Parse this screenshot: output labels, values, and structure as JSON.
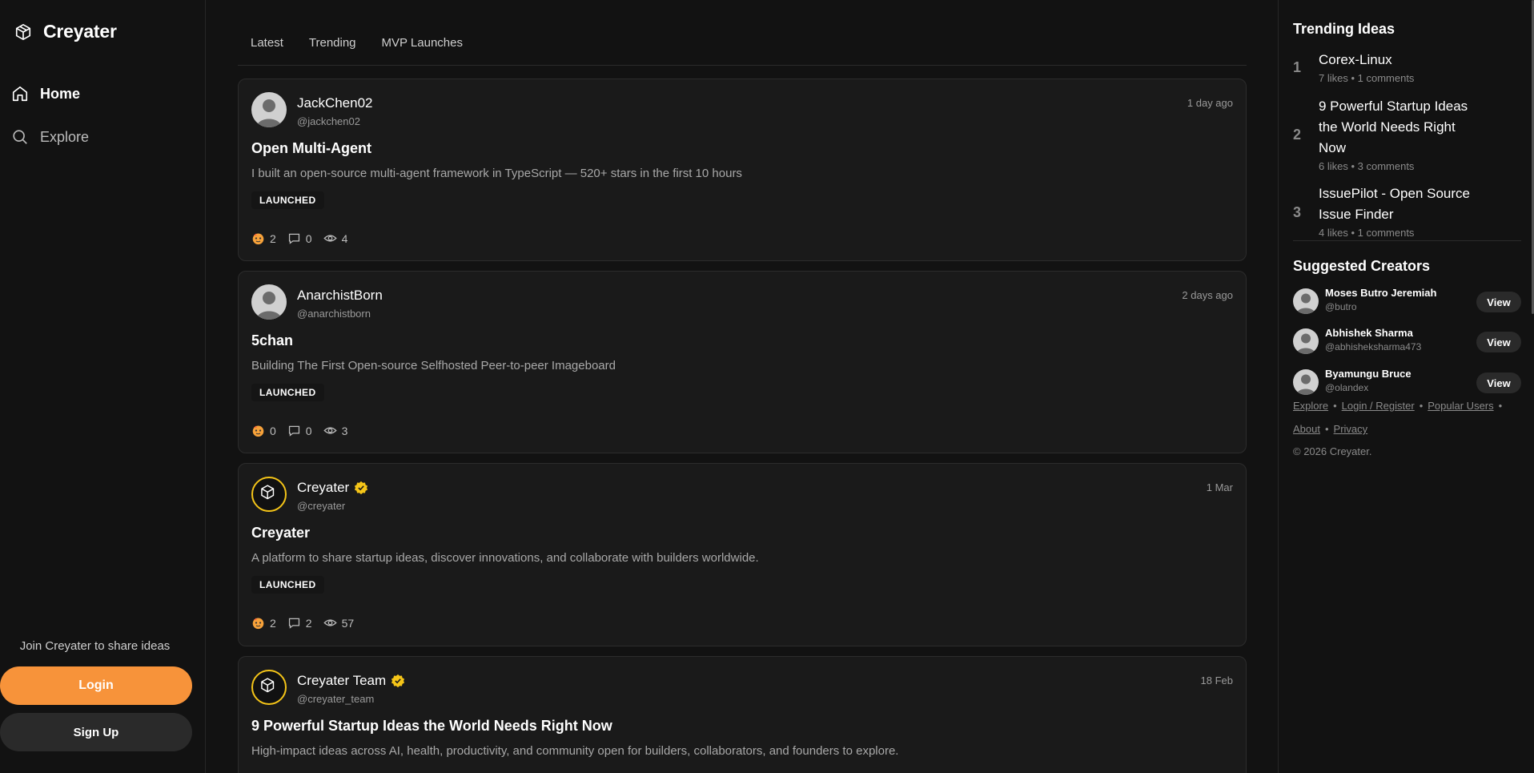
{
  "app": {
    "name": "Creyater"
  },
  "nav": [
    {
      "label": "Home",
      "icon": "home-icon",
      "active": true
    },
    {
      "label": "Explore",
      "icon": "search-icon",
      "active": false
    }
  ],
  "auth": {
    "prompt": "Join Creyater to share ideas",
    "login": "Login",
    "signup": "Sign Up"
  },
  "tabs": [
    "Latest",
    "Trending",
    "MVP Launches"
  ],
  "posts": [
    {
      "author": "JackChen02",
      "handle": "@jackchen02",
      "time": "1 day ago",
      "title": "Open Multi-Agent",
      "desc": "I built an open-source multi-agent framework in TypeScript — 520+ stars in the first 10 hours",
      "badge": "LAUNCHED",
      "likes": "2",
      "comments": "0",
      "views": "4",
      "verified": false
    },
    {
      "author": "AnarchistBorn",
      "handle": "@anarchistborn",
      "time": "2 days ago",
      "title": "5chan",
      "desc": "Building The First Open-source Selfhosted Peer-to-peer Imageboard",
      "badge": "LAUNCHED",
      "likes": "0",
      "comments": "0",
      "views": "3",
      "verified": false
    },
    {
      "author": "Creyater",
      "handle": "@creyater",
      "time": "1 Mar",
      "title": "Creyater",
      "desc": "A platform to share startup ideas, discover innovations, and collaborate with builders worldwide.",
      "badge": "LAUNCHED",
      "likes": "2",
      "comments": "2",
      "views": "57",
      "verified": true
    },
    {
      "author": "Creyater Team",
      "handle": "@creyater_team",
      "time": "18 Feb",
      "title": "9 Powerful Startup Ideas the World Needs Right Now",
      "desc": "High-impact ideas across AI, health, productivity, and community open for builders, collaborators, and founders to explore.",
      "verified": true
    }
  ],
  "trending": {
    "title": "Trending Ideas",
    "items": [
      {
        "rank": "1",
        "title": "Corex-Linux",
        "meta": "7 likes • 1 comments"
      },
      {
        "rank": "2",
        "title": "9 Powerful Startup Ideas the World Needs Right Now",
        "meta": "6 likes • 3 comments"
      },
      {
        "rank": "3",
        "title": "IssuePilot - Open Source Issue Finder",
        "meta": "4 likes • 1 comments"
      }
    ]
  },
  "creators": {
    "title": "Suggested Creators",
    "view_label": "View",
    "items": [
      {
        "name": "Moses Butro Jeremiah",
        "handle": "@butro"
      },
      {
        "name": "Abhishek Sharma",
        "handle": "@abhisheksharma473"
      },
      {
        "name": "Byamungu Bruce",
        "handle": "@olandex"
      }
    ]
  },
  "footer": {
    "links": [
      "Explore",
      "Login / Register",
      "Popular Users",
      "About",
      "Privacy"
    ],
    "copyright": "© 2026 Creyater."
  },
  "colors": {
    "accent": "#f7933a",
    "verified": "#f5c518",
    "bg": "#121212",
    "card": "#1a1a1a"
  }
}
